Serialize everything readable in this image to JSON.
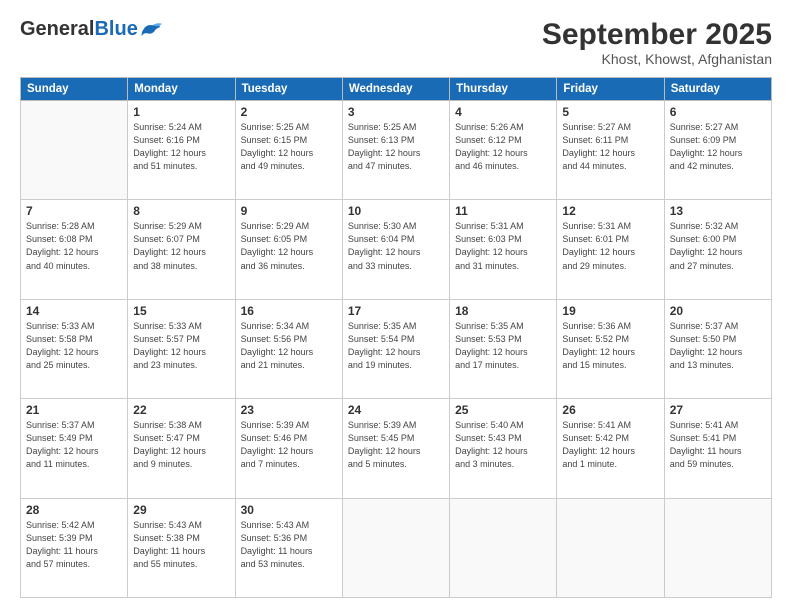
{
  "header": {
    "logo_general": "General",
    "logo_blue": "Blue",
    "title": "September 2025",
    "subtitle": "Khost, Khowst, Afghanistan"
  },
  "weekdays": [
    "Sunday",
    "Monday",
    "Tuesday",
    "Wednesday",
    "Thursday",
    "Friday",
    "Saturday"
  ],
  "weeks": [
    [
      {
        "day": "",
        "info": ""
      },
      {
        "day": "1",
        "info": "Sunrise: 5:24 AM\nSunset: 6:16 PM\nDaylight: 12 hours\nand 51 minutes."
      },
      {
        "day": "2",
        "info": "Sunrise: 5:25 AM\nSunset: 6:15 PM\nDaylight: 12 hours\nand 49 minutes."
      },
      {
        "day": "3",
        "info": "Sunrise: 5:25 AM\nSunset: 6:13 PM\nDaylight: 12 hours\nand 47 minutes."
      },
      {
        "day": "4",
        "info": "Sunrise: 5:26 AM\nSunset: 6:12 PM\nDaylight: 12 hours\nand 46 minutes."
      },
      {
        "day": "5",
        "info": "Sunrise: 5:27 AM\nSunset: 6:11 PM\nDaylight: 12 hours\nand 44 minutes."
      },
      {
        "day": "6",
        "info": "Sunrise: 5:27 AM\nSunset: 6:09 PM\nDaylight: 12 hours\nand 42 minutes."
      }
    ],
    [
      {
        "day": "7",
        "info": "Sunrise: 5:28 AM\nSunset: 6:08 PM\nDaylight: 12 hours\nand 40 minutes."
      },
      {
        "day": "8",
        "info": "Sunrise: 5:29 AM\nSunset: 6:07 PM\nDaylight: 12 hours\nand 38 minutes."
      },
      {
        "day": "9",
        "info": "Sunrise: 5:29 AM\nSunset: 6:05 PM\nDaylight: 12 hours\nand 36 minutes."
      },
      {
        "day": "10",
        "info": "Sunrise: 5:30 AM\nSunset: 6:04 PM\nDaylight: 12 hours\nand 33 minutes."
      },
      {
        "day": "11",
        "info": "Sunrise: 5:31 AM\nSunset: 6:03 PM\nDaylight: 12 hours\nand 31 minutes."
      },
      {
        "day": "12",
        "info": "Sunrise: 5:31 AM\nSunset: 6:01 PM\nDaylight: 12 hours\nand 29 minutes."
      },
      {
        "day": "13",
        "info": "Sunrise: 5:32 AM\nSunset: 6:00 PM\nDaylight: 12 hours\nand 27 minutes."
      }
    ],
    [
      {
        "day": "14",
        "info": "Sunrise: 5:33 AM\nSunset: 5:58 PM\nDaylight: 12 hours\nand 25 minutes."
      },
      {
        "day": "15",
        "info": "Sunrise: 5:33 AM\nSunset: 5:57 PM\nDaylight: 12 hours\nand 23 minutes."
      },
      {
        "day": "16",
        "info": "Sunrise: 5:34 AM\nSunset: 5:56 PM\nDaylight: 12 hours\nand 21 minutes."
      },
      {
        "day": "17",
        "info": "Sunrise: 5:35 AM\nSunset: 5:54 PM\nDaylight: 12 hours\nand 19 minutes."
      },
      {
        "day": "18",
        "info": "Sunrise: 5:35 AM\nSunset: 5:53 PM\nDaylight: 12 hours\nand 17 minutes."
      },
      {
        "day": "19",
        "info": "Sunrise: 5:36 AM\nSunset: 5:52 PM\nDaylight: 12 hours\nand 15 minutes."
      },
      {
        "day": "20",
        "info": "Sunrise: 5:37 AM\nSunset: 5:50 PM\nDaylight: 12 hours\nand 13 minutes."
      }
    ],
    [
      {
        "day": "21",
        "info": "Sunrise: 5:37 AM\nSunset: 5:49 PM\nDaylight: 12 hours\nand 11 minutes."
      },
      {
        "day": "22",
        "info": "Sunrise: 5:38 AM\nSunset: 5:47 PM\nDaylight: 12 hours\nand 9 minutes."
      },
      {
        "day": "23",
        "info": "Sunrise: 5:39 AM\nSunset: 5:46 PM\nDaylight: 12 hours\nand 7 minutes."
      },
      {
        "day": "24",
        "info": "Sunrise: 5:39 AM\nSunset: 5:45 PM\nDaylight: 12 hours\nand 5 minutes."
      },
      {
        "day": "25",
        "info": "Sunrise: 5:40 AM\nSunset: 5:43 PM\nDaylight: 12 hours\nand 3 minutes."
      },
      {
        "day": "26",
        "info": "Sunrise: 5:41 AM\nSunset: 5:42 PM\nDaylight: 12 hours\nand 1 minute."
      },
      {
        "day": "27",
        "info": "Sunrise: 5:41 AM\nSunset: 5:41 PM\nDaylight: 11 hours\nand 59 minutes."
      }
    ],
    [
      {
        "day": "28",
        "info": "Sunrise: 5:42 AM\nSunset: 5:39 PM\nDaylight: 11 hours\nand 57 minutes."
      },
      {
        "day": "29",
        "info": "Sunrise: 5:43 AM\nSunset: 5:38 PM\nDaylight: 11 hours\nand 55 minutes."
      },
      {
        "day": "30",
        "info": "Sunrise: 5:43 AM\nSunset: 5:36 PM\nDaylight: 11 hours\nand 53 minutes."
      },
      {
        "day": "",
        "info": ""
      },
      {
        "day": "",
        "info": ""
      },
      {
        "day": "",
        "info": ""
      },
      {
        "day": "",
        "info": ""
      }
    ]
  ]
}
